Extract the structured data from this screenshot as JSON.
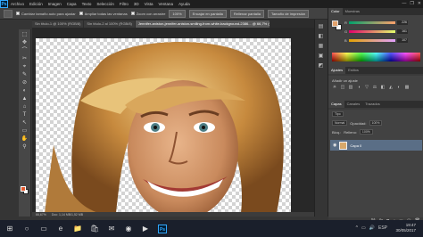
{
  "app": {
    "logo": "Ps"
  },
  "menu": [
    "Archivo",
    "Edición",
    "Imagen",
    "Capa",
    "Texto",
    "Selección",
    "Filtro",
    "3D",
    "Vista",
    "Ventana",
    "Ayuda"
  ],
  "window_controls": [
    "—",
    "❐",
    "✕"
  ],
  "options": {
    "check1": "Cambiar tamaño auto para ajustar",
    "check2": "Ampliar todas las ventanas",
    "check3": "Zoom con arrastre",
    "btn1": "100%",
    "btn2": "Encajar en pantalla",
    "btn3": "Rellenar pantalla",
    "btn4": "Tamaño de impresión",
    "workspace_select": "Aspectos esenciales"
  },
  "tabs": [
    {
      "label": "Sin título-1 @ 100% (RGB/8)",
      "active": false
    },
    {
      "label": "Sin título-2 al 100% (RGB/8)",
      "active": false
    },
    {
      "label": "Jennifer-aniston-jennifer-aniston-smiling-from-white-background-2386... @ 66,7% (Capa 0, RGB/8)",
      "active": true
    }
  ],
  "tools": [
    "⬚",
    "✥",
    "⌒",
    "✂",
    "⌖",
    "✎",
    "⊘",
    "◐",
    "▲",
    "⌂",
    "T",
    "↖",
    "▭",
    "✋",
    "⚲"
  ],
  "status": {
    "zoom": "66,67%",
    "doc": "Doc: 1,14 MB/1,52 MB"
  },
  "dock_icons": [
    "▤",
    "◧",
    "▦",
    "▣",
    "◩"
  ],
  "color_panel": {
    "tabs": [
      "Color",
      "Muestras"
    ],
    "sliders": [
      {
        "label": "R",
        "value": "226"
      },
      {
        "label": "G",
        "value": "161"
      },
      {
        "label": "B",
        "value": "107"
      }
    ],
    "fg_color": "#e2a16b"
  },
  "adjust_panel": {
    "tabs": [
      "Ajustes",
      "Estilos"
    ],
    "title": "Añadir un ajuste",
    "icons": [
      "☀",
      "◫",
      "▥",
      "◑",
      "▽",
      "⚖",
      "◧",
      "◭",
      "◐",
      "▩"
    ]
  },
  "layers_panel": {
    "tabs": [
      "Capas",
      "Canales",
      "Trazados"
    ],
    "kind": "Tipo",
    "blend": "Normal",
    "opacity_label": "Opacidad:",
    "opacity": "100%",
    "lock_label": "Bloq.:",
    "fill_label": "Relleno:",
    "fill": "100%",
    "layer_name": "Capa 0",
    "bottom_icons": [
      "⛓",
      "fx",
      "◙",
      "◑",
      "▭",
      "▢",
      "🗑"
    ]
  },
  "taskbar": {
    "icons": [
      "⊞",
      "○",
      "▭",
      "e",
      "📁",
      "🛍",
      "✉",
      "◉",
      "▶"
    ],
    "ps": "Ps",
    "tray": [
      "^",
      "▭",
      "🔊",
      "ESP"
    ],
    "time": "19:47",
    "date": "30/05/2017"
  }
}
